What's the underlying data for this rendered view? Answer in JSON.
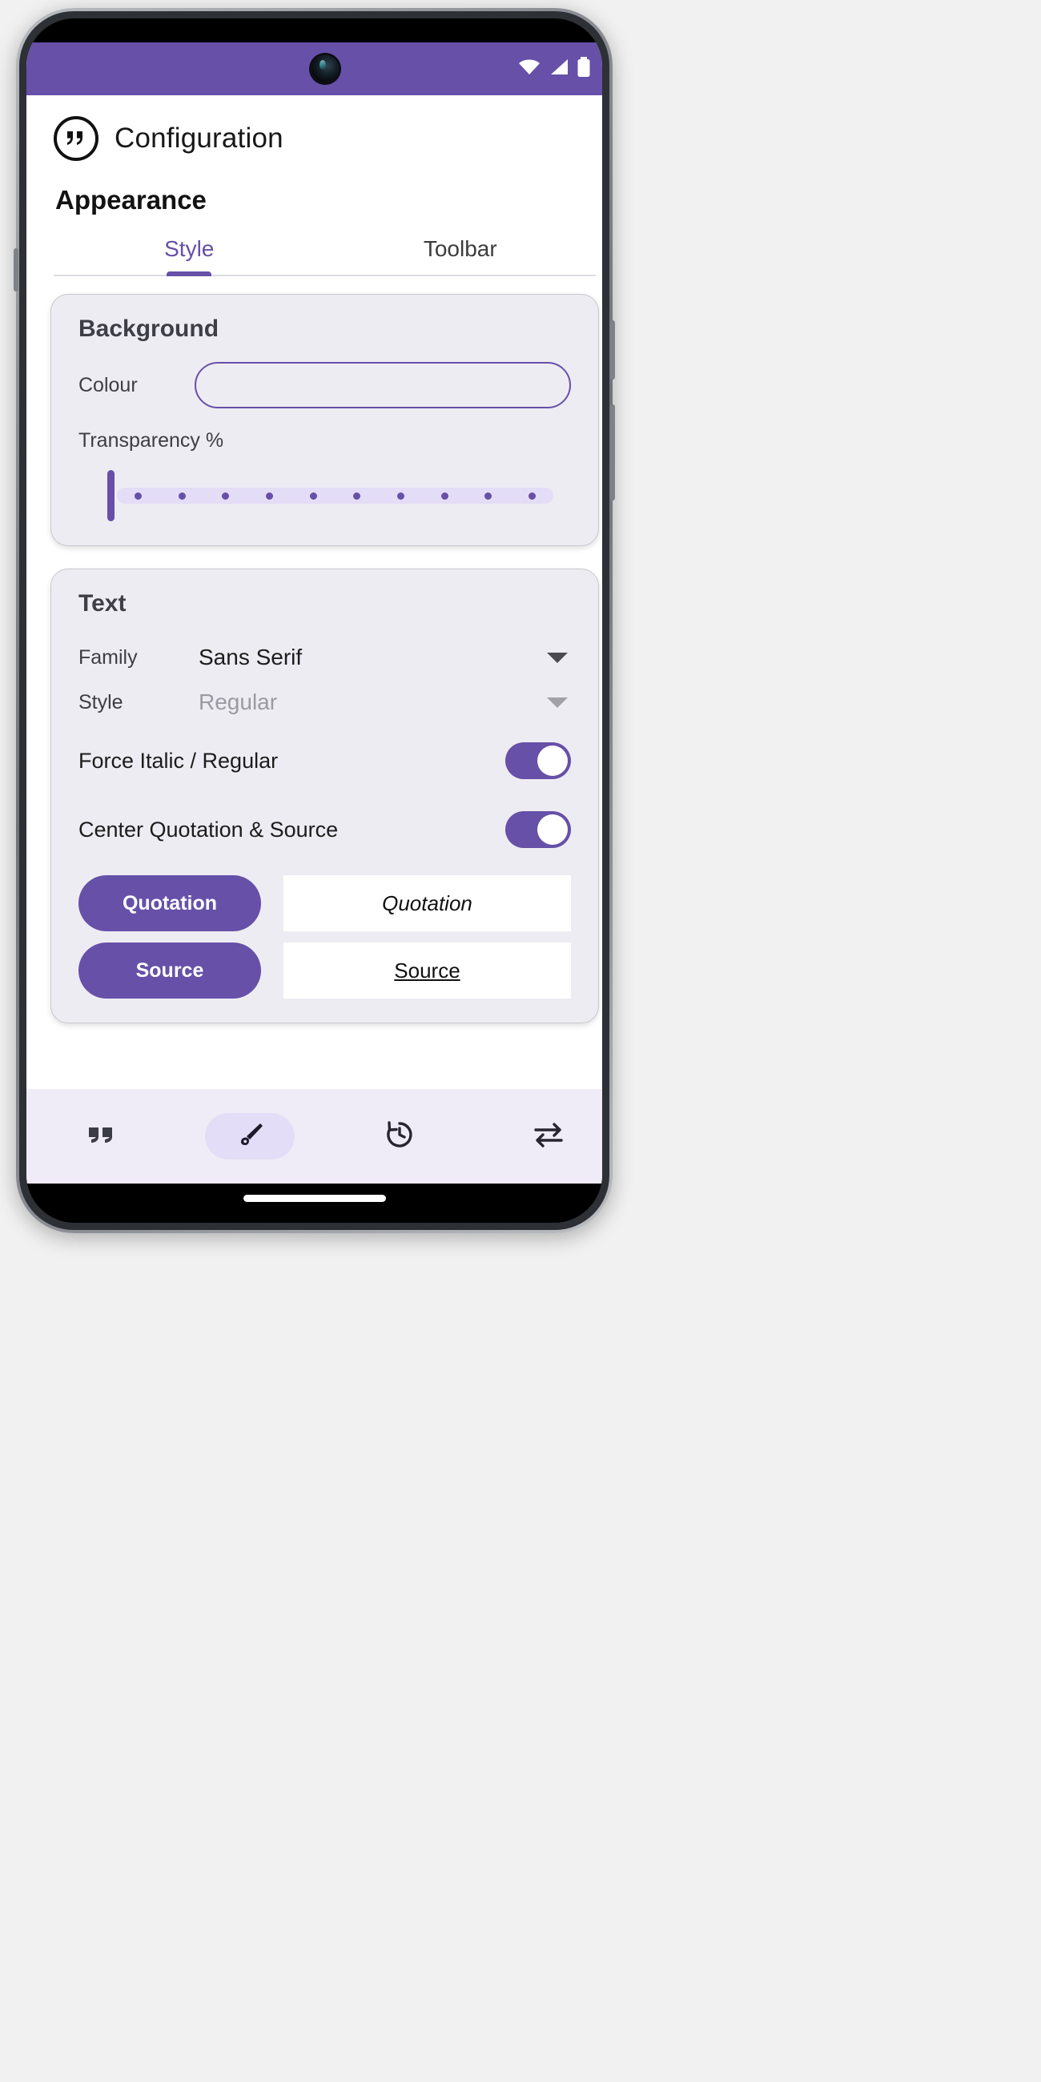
{
  "statusbar": {
    "icons": [
      "wifi-icon",
      "signal-icon",
      "battery-icon"
    ]
  },
  "header": {
    "app_icon": "quotation-circle-icon",
    "title": "Configuration",
    "section": "Appearance"
  },
  "tabs": [
    {
      "label": "Style",
      "active": true
    },
    {
      "label": "Toolbar",
      "active": false
    }
  ],
  "background_card": {
    "title": "Background",
    "colour_label": "Colour",
    "colour_value": "",
    "transparency_label": "Transparency %",
    "transparency_value": 0,
    "tick_count": 10
  },
  "text_card": {
    "title": "Text",
    "family_label": "Family",
    "family_value": "Sans Serif",
    "style_label": "Style",
    "style_value": "Regular",
    "force_italic_label": "Force Italic / Regular",
    "force_italic_on": true,
    "center_label": "Center Quotation & Source",
    "center_on": true,
    "quotation_button": "Quotation",
    "quotation_preview": "Quotation",
    "source_button": "Source",
    "source_preview": "Source"
  },
  "bottom_nav": [
    {
      "icon": "quotation-marks-icon",
      "active": false
    },
    {
      "icon": "paintbrush-icon",
      "active": true
    },
    {
      "icon": "history-icon",
      "active": false
    },
    {
      "icon": "swap-arrows-icon",
      "active": false
    }
  ],
  "colors": {
    "accent": "#6650a8",
    "card_bg": "#eeecf3",
    "nav_bg": "#f0ecf7",
    "track": "#e4ddf7"
  }
}
